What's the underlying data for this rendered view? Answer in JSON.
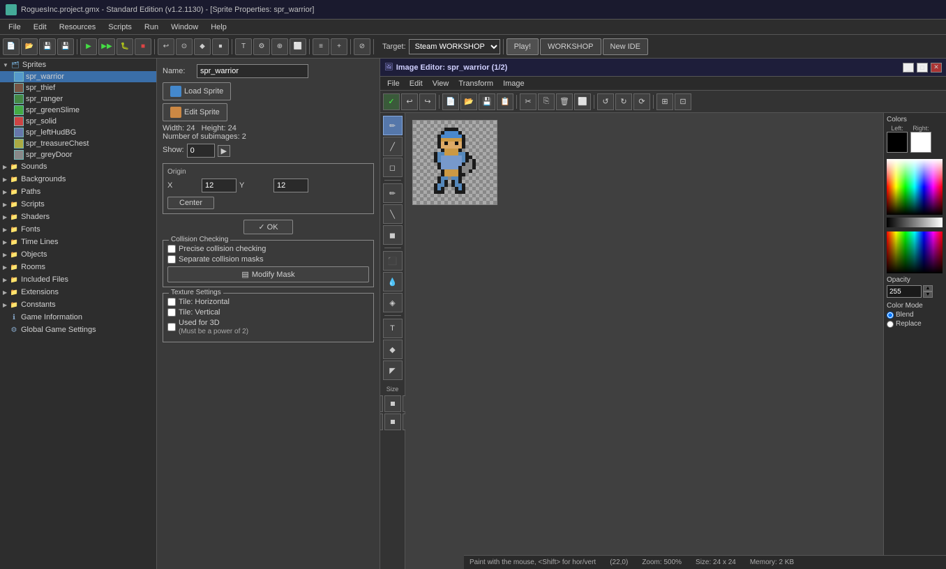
{
  "titlebar": {
    "text": "RoguesInc.project.gmx  -  Standard Edition (v1.2.1130) - [Sprite Properties: spr_warrior]"
  },
  "menubar": {
    "items": [
      "File",
      "Edit",
      "Resources",
      "Scripts",
      "Run",
      "Window",
      "Help"
    ]
  },
  "toolbar": {
    "target_label": "Target:",
    "target_value": "Steam WORKSHOP",
    "play_label": "Play!",
    "workshop_label": "WORKSHOP",
    "new_ide_label": "New IDE"
  },
  "sidebar": {
    "sprites_label": "Sprites",
    "sprites": [
      {
        "name": "spr_warrior",
        "selected": true
      },
      {
        "name": "spr_thief",
        "selected": false
      },
      {
        "name": "spr_ranger",
        "selected": false
      },
      {
        "name": "spr_greenSlime",
        "selected": false
      },
      {
        "name": "spr_solid",
        "selected": false
      },
      {
        "name": "spr_leftHudBG",
        "selected": false
      },
      {
        "name": "spr_treasureChest",
        "selected": false
      },
      {
        "name": "spr_greyDoor",
        "selected": false
      }
    ],
    "groups": [
      {
        "name": "Sounds",
        "expanded": false
      },
      {
        "name": "Backgrounds",
        "expanded": false
      },
      {
        "name": "Paths",
        "expanded": false
      },
      {
        "name": "Scripts",
        "expanded": false
      },
      {
        "name": "Shaders",
        "expanded": false
      },
      {
        "name": "Fonts",
        "expanded": false
      },
      {
        "name": "Time Lines",
        "expanded": false
      },
      {
        "name": "Objects",
        "expanded": false
      },
      {
        "name": "Rooms",
        "expanded": false
      },
      {
        "name": "Included Files",
        "expanded": false
      },
      {
        "name": "Extensions",
        "expanded": false
      },
      {
        "name": "Constants",
        "expanded": false
      }
    ],
    "bottom_items": [
      {
        "name": "Game Information"
      },
      {
        "name": "Global Game Settings"
      }
    ]
  },
  "sprite_props": {
    "name_label": "Name:",
    "name_value": "spr_warrior",
    "load_sprite_label": "Load Sprite",
    "edit_sprite_label": "Edit Sprite",
    "width_label": "Width:",
    "width_value": "24",
    "height_label": "Height:",
    "height_value": "24",
    "subimages_label": "Number of subimages:",
    "subimages_value": "2",
    "show_label": "Show:",
    "show_value": "0",
    "origin_label": "Origin",
    "origin_x_label": "X",
    "origin_x_value": "12",
    "origin_y_label": "Y",
    "origin_y_value": "12",
    "center_label": "Center",
    "ok_label": "✓ OK",
    "collision_title": "Collision Checking",
    "precise_label": "Precise collision checking",
    "separate_label": "Separate collision masks",
    "modify_mask_label": "Modify Mask",
    "texture_title": "Texture Settings",
    "tile_h_label": "Tile: Horizontal",
    "tile_v_label": "Tile: Vertical",
    "used_3d_label": "Used for 3D",
    "used_3d_note": "(Must be a power of 2)"
  },
  "image_editor": {
    "title": "Image Editor: spr_warrior (1/2)",
    "menubar": [
      "File",
      "Edit",
      "View",
      "Transform",
      "Image"
    ],
    "statusbar": {
      "paint_text": "Paint with the mouse, <Shift> for hor/vert",
      "coords": "(22,0)",
      "zoom": "Zoom: 500%",
      "size": "Size: 24 x 24",
      "memory": "Memory: 2 KB"
    }
  },
  "colors": {
    "title": "Colors",
    "left_label": "Left:",
    "right_label": "Right:",
    "opacity_label": "Opacity",
    "opacity_value": "255",
    "color_mode_label": "Color Mode",
    "blend_label": "Blend",
    "replace_label": "Replace"
  }
}
